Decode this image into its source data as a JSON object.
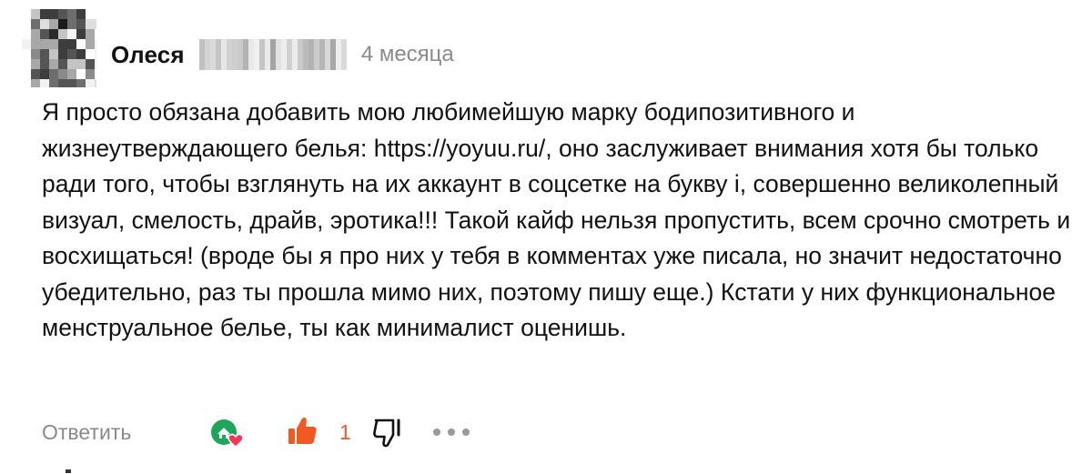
{
  "comment": {
    "author_name": "Олеся",
    "timestamp": "4 месяца",
    "text": "Я просто обязана добавить мою любимейшую марку бодипозитивного и жизнеутверждающего белья: https://yoyuu.ru/, оно заслуживает внимания хотя бы только ради того, чтобы взглянуть на их аккаунт в соцсетке на букву i, совершенно великолепный визуал, смелость, драйв, эротика!!! Такой кайф нельзя пропустить, всем срочно смотреть и восхищаться! (вроде бы я про них у тебя в комментах уже писала, но значит недостаточно убедительно, раз ты прошла мимо них, поэтому пишу еще.) Кстати у них функциональное менструальное белье, ты как минималист оценишь."
  },
  "actions": {
    "reply_label": "Ответить",
    "like_count": "1",
    "icons": {
      "reaction": "green-house-heart-icon",
      "like": "thumbs-up-icon",
      "dislike": "thumbs-down-icon",
      "more": "more-dots-icon"
    }
  },
  "colors": {
    "accent": "#f05a22",
    "muted_text": "#8a8a8a",
    "reaction_green": "#1fa55a",
    "reaction_heart": "#f0395a"
  }
}
